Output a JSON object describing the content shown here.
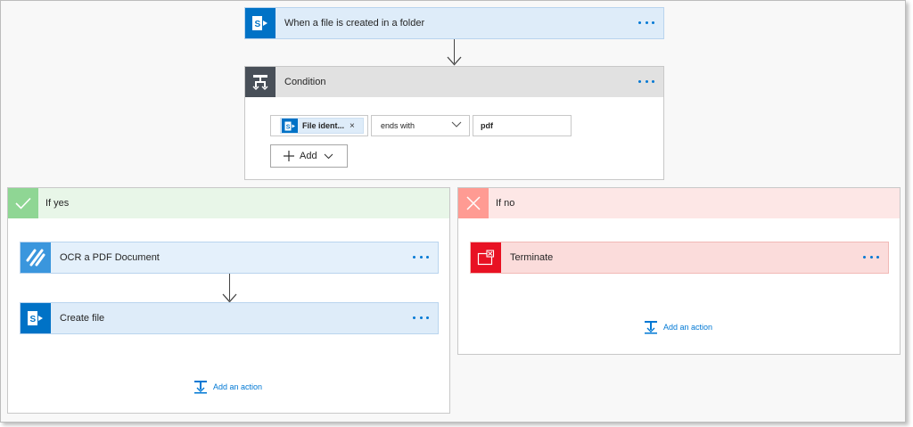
{
  "trigger": {
    "title": "When a file is created in a folder",
    "icon": "sharepoint-icon"
  },
  "condition": {
    "title": "Condition",
    "icon": "condition-icon",
    "token_label": "File ident...",
    "token_remove": "×",
    "operator": "ends with",
    "value": "pdf",
    "add_label": "Add"
  },
  "if_yes": {
    "title": "If yes",
    "actions": [
      {
        "title": "OCR a PDF Document",
        "icon": "ocr-icon"
      },
      {
        "title": "Create file",
        "icon": "sharepoint-icon"
      }
    ],
    "add_action_label": "Add an action"
  },
  "if_no": {
    "title": "If no",
    "actions": [
      {
        "title": "Terminate",
        "icon": "terminate-icon"
      }
    ],
    "add_action_label": "Add an action"
  },
  "colors": {
    "sharepoint": "#0072c6",
    "condition": "#484f58",
    "yes": "#8fd694",
    "no": "#ff9b93",
    "ocr": "#3a96dd",
    "terminate": "#e81123",
    "link": "#0078d4"
  }
}
